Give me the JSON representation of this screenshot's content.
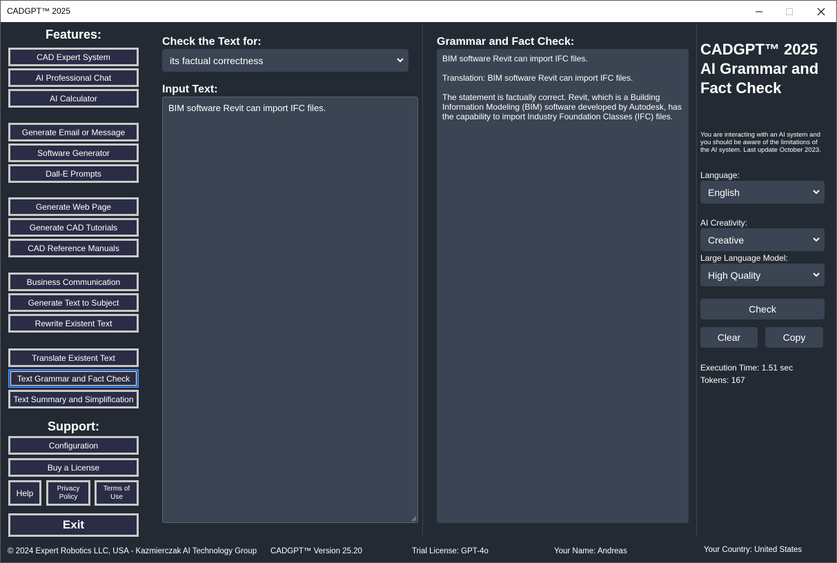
{
  "window": {
    "title": "CADGPT™ 2025",
    "controls": [
      "minimize-icon",
      "maximize-icon",
      "close-icon"
    ]
  },
  "sidebar": {
    "features_heading": "Features:",
    "support_heading": "Support:",
    "groups": [
      [
        "CAD Expert System",
        "AI Professional Chat",
        "AI Calculator"
      ],
      [
        "Generate Email or Message",
        "Software Generator",
        "Dall-E Prompts"
      ],
      [
        "Generate Web Page",
        "Generate CAD Tutorials",
        "CAD Reference Manuals"
      ],
      [
        "Business Communication",
        "Generate Text to Subject",
        "Rewrite Existent Text"
      ],
      [
        "Translate Existent Text",
        "Text Grammar and Fact Check",
        "Text Summary and Simplification"
      ]
    ],
    "active_item": "Text Grammar and Fact Check",
    "support": {
      "configuration": "Configuration",
      "buy_license": "Buy a License",
      "help": "Help",
      "privacy": "Privacy\nPolicy",
      "terms": "Terms of\nUse",
      "exit": "Exit"
    }
  },
  "input_panel": {
    "check_label": "Check the Text for:",
    "check_selected": "its factual correctness",
    "input_label": "Input Text:",
    "input_value": "BIM software Revit can import IFC files."
  },
  "output_panel": {
    "label": "Grammar and Fact Check:",
    "paragraphs": [
      "BIM software Revit can import IFC files.",
      "Translation: BIM software Revit can import IFC files.",
      "The statement is factually correct. Revit, which is a Building Information Modeling (BIM) software developed by Autodesk, has the capability to import Industry Foundation Classes (IFC) files."
    ]
  },
  "settings": {
    "app_title": "CADGPT™ 2025\nAI Grammar and Fact Check",
    "notice": "You are interacting with an AI system and you should be aware of the limitations of the AI system. Last update October 2023.",
    "language_label": "Language:",
    "language_value": "English",
    "creativity_label": "AI Creativity:",
    "creativity_value": "Creative",
    "model_label": "Large Language Model:",
    "model_value": "High Quality",
    "check_button": "Check",
    "clear_button": "Clear",
    "copy_button": "Copy",
    "execution_time": "Execution Time: 1.51 sec",
    "tokens": "Tokens: 167"
  },
  "footer": {
    "copyright": "© 2024 Expert Robotics LLC, USA - Kazmierczak AI Technology Group",
    "version": "CADGPT™ Version 25.20",
    "license": "Trial License: GPT-4o",
    "user": "Your Name: Andreas",
    "country": "Your Country: United States"
  }
}
